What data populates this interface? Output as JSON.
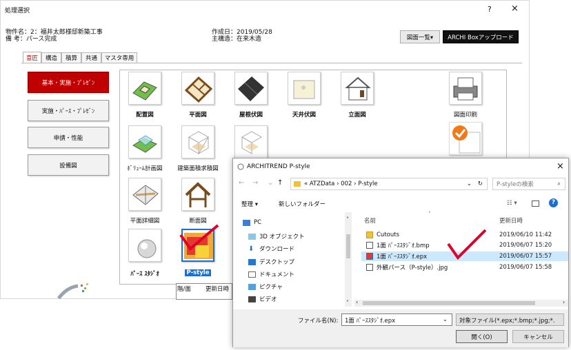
{
  "main": {
    "title": "処理選択",
    "help": "?",
    "close": "×",
    "property_label": "物件名：2：福井太郎様邸新築工事",
    "remark_label": "備  考：パース完成",
    "created_label": "作成日：2019/05/28",
    "structure_label": "主構造：在来木造",
    "drawing_list_btn": "図面一覧▾",
    "upload_btn": "ARCHI Boxアップロード",
    "tabs": [
      "意匠",
      "構造",
      "積算",
      "共通",
      "マスタ専用"
    ],
    "categories": [
      "基本・実施・ﾌﾟﾚｾﾞﾝ",
      "実施・ﾊﾟｰｽ・ﾌﾟﾚｾﾞﾝ",
      "申請・性能",
      "設備図"
    ],
    "icons": [
      {
        "label": "配置図"
      },
      {
        "label": "平面図"
      },
      {
        "label": "屋根伏図"
      },
      {
        "label": "天井伏図"
      },
      {
        "label": "立面図"
      },
      {
        "label": "図面印刷"
      },
      {
        "label": "ﾎﾞﾘｭｰﾑ計画図"
      },
      {
        "label": "建築面積求積図"
      },
      {
        "label": "平面詳細図"
      },
      {
        "label": "断面図"
      },
      {
        "label": "ﾊﾟｰｽ ｽﾀｼﾞｵ"
      },
      {
        "label": "P-style"
      }
    ],
    "grid_headers": [
      "階/面",
      "更新日時"
    ]
  },
  "dialog": {
    "title": "ARCHITREND P-style",
    "close": "×",
    "nav": {
      "back": "←",
      "forward": "→",
      "up": "↑",
      "path": "« ATZData › 002 › P-style",
      "search_placeholder": "P-styleの検索"
    },
    "organize": "整理 ▾",
    "new_folder": "新しいフォルダー",
    "tree": [
      "PC",
      "3D オブジェクト",
      "ダウンロード",
      "デスクトップ",
      "ドキュメント",
      "ピクチャ",
      "ビデオ"
    ],
    "columns": {
      "name": "名前",
      "date": "更新日時"
    },
    "files": [
      {
        "name": "Cutouts",
        "date": "2019/06/10 11:42"
      },
      {
        "name": "1面 ﾊﾟｰｽｽﾀｼﾞｵ.bmp",
        "date": "2019/06/07 15:20"
      },
      {
        "name": "1面 ﾊﾟｰｽｽﾀｼﾞｵ.epx",
        "date": "2019/06/07 15:57"
      },
      {
        "name": "外観パース（P-style）.jpg",
        "date": "2019/06/07 15:58"
      }
    ],
    "filename_label": "ファイル名(N):",
    "filename_value": "1面 ﾊﾟｰｽｽﾀｼﾞｵ.epx",
    "filter_value": "対象ファイル(*.epx;*.bmp;*.jpg;*.",
    "open_btn": "開く(O)",
    "cancel_btn": "キャンセル"
  },
  "colors": {
    "accent_red": "#c00000",
    "selection_blue": "#1c6fd0",
    "check_red": "#e0002a"
  }
}
